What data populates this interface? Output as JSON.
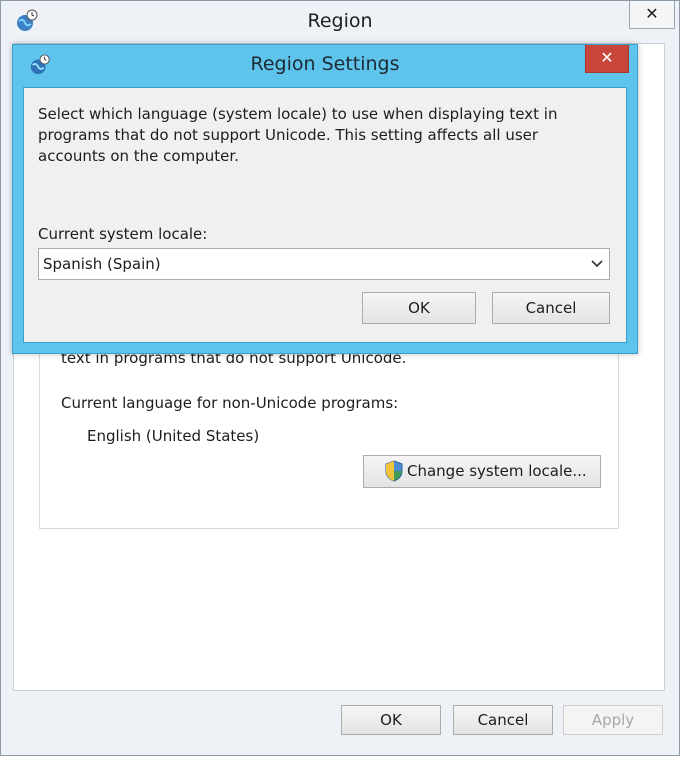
{
  "outer_window": {
    "title": "Region",
    "close_glyph": "✕",
    "partial_text_line": "text in programs that do not support Unicode.",
    "current_language_label": "Current language for non-Unicode programs:",
    "current_language_value": "English (United States)",
    "change_locale_button": "Change system locale...",
    "buttons": {
      "ok": "OK",
      "cancel": "Cancel",
      "apply": "Apply"
    }
  },
  "dialog": {
    "title": "Region Settings",
    "close_glyph": "✕",
    "description": "Select which language (system locale) to use when displaying text in programs that do not support Unicode. This setting affects all user accounts on the computer.",
    "locale_label": "Current system locale:",
    "locale_value": "Spanish (Spain)",
    "buttons": {
      "ok": "OK",
      "cancel": "Cancel"
    }
  },
  "colors": {
    "dialog_frame": "#5fc4ec",
    "close_button_red": "#c8453a",
    "outer_frame": "#eef2f6"
  },
  "icons": [
    "globe-clock-icon",
    "close-icon",
    "shield-icon",
    "chevron-down-icon"
  ]
}
